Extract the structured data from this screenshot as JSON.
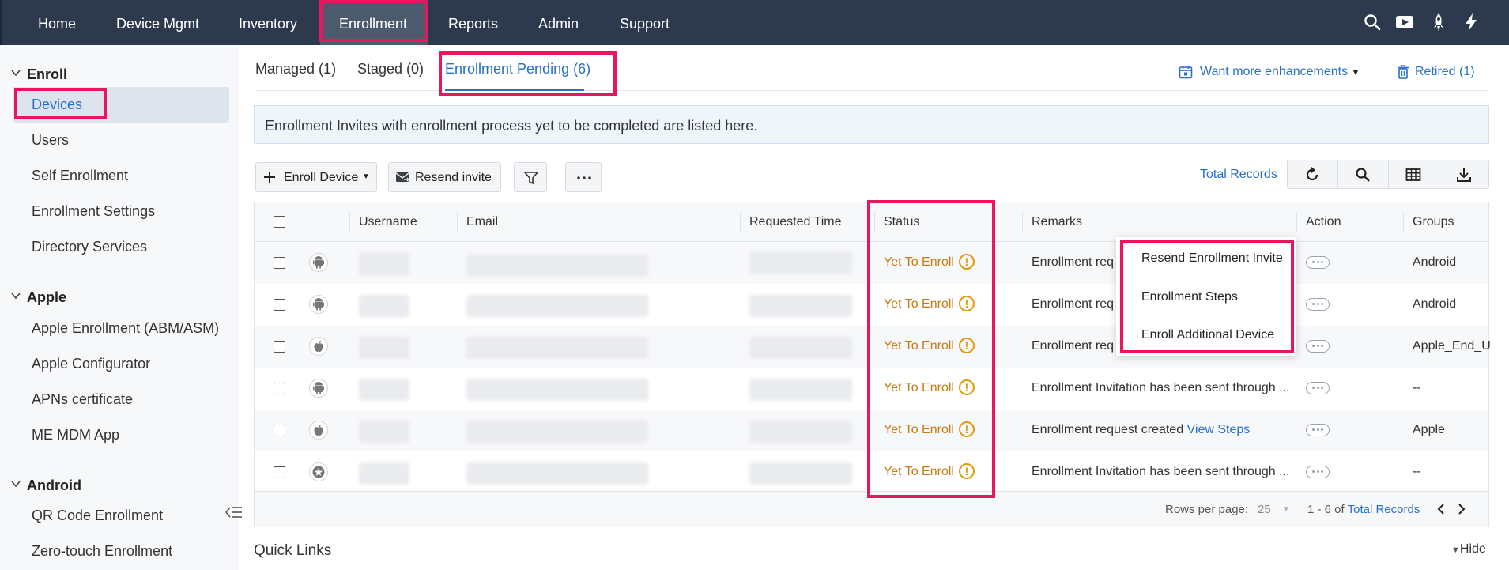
{
  "topnav": {
    "items": [
      "Home",
      "Device Mgmt",
      "Inventory",
      "Enrollment",
      "Reports",
      "Admin",
      "Support"
    ],
    "active": "Enrollment",
    "icons": [
      "search-icon",
      "video-icon",
      "rocket-icon",
      "lightning-icon"
    ]
  },
  "sidebar": {
    "groups": [
      {
        "label": "Enroll",
        "items": [
          "Devices",
          "Users",
          "Self Enrollment",
          "Enrollment Settings",
          "Directory Services"
        ]
      },
      {
        "label": "Apple",
        "items": [
          "Apple Enrollment (ABM/ASM)",
          "Apple Configurator",
          "APNs certificate",
          "ME MDM App"
        ]
      },
      {
        "label": "Android",
        "items": [
          "QR Code Enrollment",
          "Zero-touch Enrollment"
        ]
      }
    ],
    "active": "Devices"
  },
  "tabs": [
    "Managed (1)",
    "Staged (0)",
    "Enrollment Pending (6)"
  ],
  "links": {
    "enhancements": "Want more enhancements",
    "retired": "Retired (1)"
  },
  "banner": "Enrollment Invites with enrollment process yet to be completed are listed here.",
  "toolbar": {
    "enroll": "Enroll Device",
    "resend": "Resend invite",
    "total_records": "Total Records"
  },
  "table": {
    "headers": [
      "Username",
      "Email",
      "Requested Time",
      "Status",
      "Remarks",
      "Action",
      "Groups"
    ],
    "rows": [
      {
        "os": "android-icon",
        "status": "Yet To Enroll",
        "remark": "Enrollment req",
        "remark_link": "",
        "group": "Android"
      },
      {
        "os": "android-icon",
        "status": "Yet To Enroll",
        "remark": "Enrollment req",
        "remark_link": "",
        "group": "Android"
      },
      {
        "os": "apple-icon",
        "status": "Yet To Enroll",
        "remark": "Enrollment req",
        "remark_link": "",
        "group": "Apple_End_U"
      },
      {
        "os": "android-icon",
        "status": "Yet To Enroll",
        "remark": "Enrollment Invitation has been sent through ...",
        "remark_link": "",
        "group": "--"
      },
      {
        "os": "apple-icon",
        "status": "Yet To Enroll",
        "remark": "Enrollment request created ",
        "remark_link": "View Steps",
        "group": "Apple"
      },
      {
        "os": "other-icon",
        "status": "Yet To Enroll",
        "remark": "Enrollment Invitation has been sent through ...",
        "remark_link": "",
        "group": "--"
      }
    ],
    "footer": {
      "rows_per_page_label": "Rows per page:",
      "rows_per_page": "25",
      "range": "1 - 6 of",
      "total_link": "Total Records"
    }
  },
  "action_menu": [
    "Resend Enrollment Invite",
    "Enrollment Steps",
    "Enroll Additional Device"
  ],
  "quick_links": "Quick Links",
  "hide": "Hide",
  "colors": {
    "nav_bg": "#2d3a4e",
    "accent": "#2870c8",
    "highlight": "#e8175d",
    "status": "#c77a12"
  }
}
